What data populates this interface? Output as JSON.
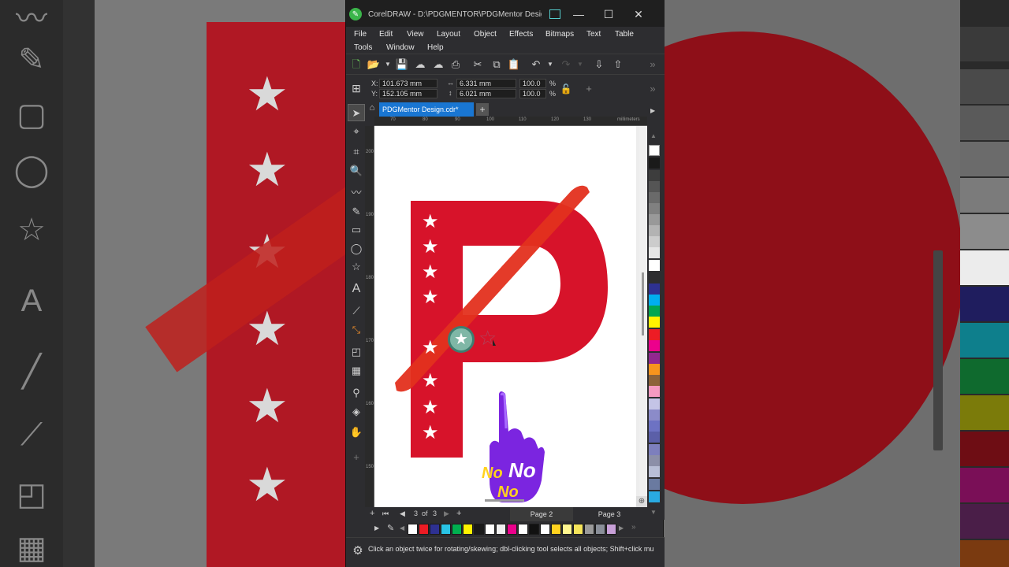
{
  "window": {
    "title": "CorelDRAW - D:\\PDGMENTOR\\PDGMentor Desig..*",
    "minimize_glyph": "—",
    "maximize_glyph": "☐",
    "close_glyph": "✕"
  },
  "menu": {
    "items": [
      "File",
      "Edit",
      "View",
      "Layout",
      "Object",
      "Effects",
      "Bitmaps",
      "Text",
      "Table",
      "Tools",
      "Window",
      "Help"
    ]
  },
  "property_bar": {
    "x_label": "X:",
    "x_value": "101.673 mm",
    "y_label": "Y:",
    "y_value": "152.105 mm",
    "width_value": "6.331 mm",
    "height_value": "6.021 mm",
    "scale_x": "100.0",
    "scale_y": "100.0",
    "percent": "%"
  },
  "document_tab": {
    "name": "PDGMentor Design.cdr*",
    "add": "+"
  },
  "ruler": {
    "h_ticks": [
      "70",
      "80",
      "90",
      "100",
      "110",
      "120",
      "130"
    ],
    "h_unit": "millimeters",
    "v_ticks": [
      "200",
      "190",
      "180",
      "170",
      "160",
      "150"
    ],
    "v_unit": "millimeters"
  },
  "canvas": {
    "letter": "P",
    "sticker_text_1": "No",
    "sticker_text_2": "No",
    "sticker_text_3": "No",
    "star_glyph": "★",
    "star_outline_glyph": "☆"
  },
  "page_nav": {
    "current": "3",
    "of_label": "of",
    "total": "3",
    "pages": [
      "Page 2",
      "Page 3"
    ]
  },
  "status": {
    "hint": "Click an object twice for rotating/skewing; dbl-clicking tool selects all objects; Shift+click mu"
  },
  "colors": {
    "app_bg": "#2d2d30",
    "accent": "#1976d2",
    "logo_red": "#d7132a",
    "brush_red": "#e3301e",
    "hand_purple": "#7b25e0",
    "sticker_yellow": "#ffd21f"
  },
  "icons": {
    "app": "coreldraw-logo-icon",
    "status": "gear-icon"
  }
}
